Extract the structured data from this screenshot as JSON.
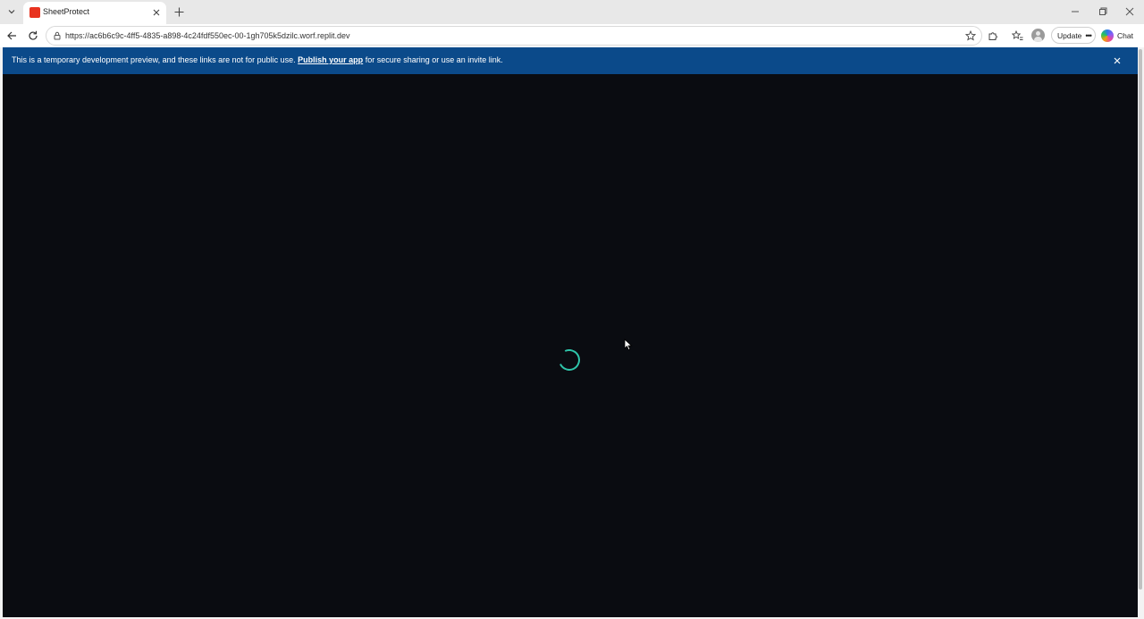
{
  "browser": {
    "tab": {
      "title": "SheetProtect",
      "favicon_color": "#e8331f"
    },
    "address_bar": {
      "url": "https://ac6b6c9c-4ff5-4835-a898-4c24fdf550ec-00-1gh705k5dzilc.worf.replit.dev"
    },
    "toolbar": {
      "update_label": "Update",
      "chat_label": "Chat"
    }
  },
  "banner": {
    "text_before": "This is a temporary development preview, and these links are not for public use. ",
    "link_text": "Publish your app",
    "text_after": " for secure sharing or use an invite link.",
    "background": "#0b4a8a"
  },
  "page": {
    "background": "#0a0c11",
    "spinner_color": "#2ec4a9",
    "state": "loading"
  }
}
